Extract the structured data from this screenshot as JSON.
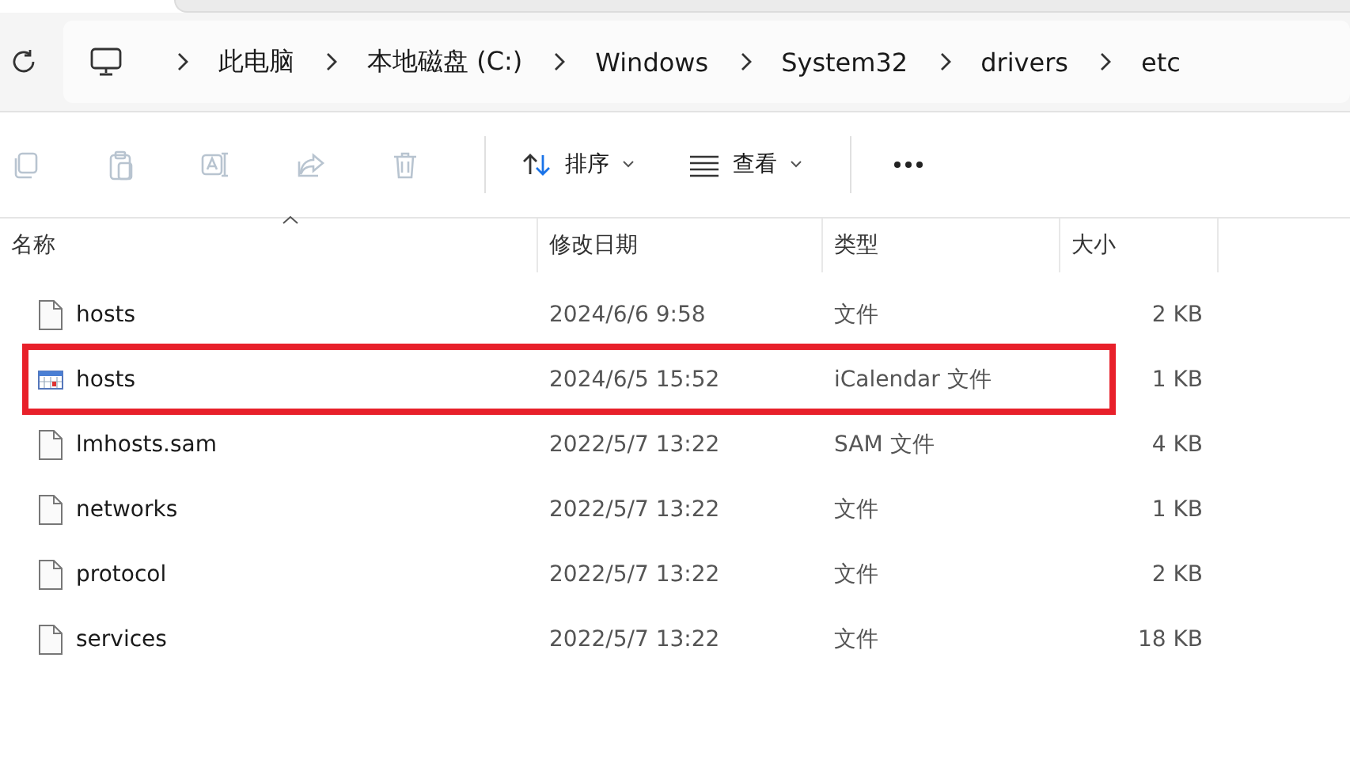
{
  "address_bar": {
    "crumbs": [
      "此电脑",
      "本地磁盘 (C:)",
      "Windows",
      "System32",
      "drivers",
      "etc"
    ]
  },
  "toolbar": {
    "actions": [
      {
        "kind": "copy",
        "disabled": true
      },
      {
        "kind": "paste",
        "disabled": true
      },
      {
        "kind": "rename",
        "disabled": true
      },
      {
        "kind": "share",
        "disabled": true
      },
      {
        "kind": "delete",
        "disabled": true
      }
    ],
    "sort": {
      "label": "排序"
    },
    "view": {
      "label": "查看"
    }
  },
  "table": {
    "columns": [
      "名称",
      "修改日期",
      "类型",
      "大小"
    ],
    "rows": [
      {
        "kind": "file",
        "name": "hosts",
        "modified": "2024/6/6 9:58",
        "type": "文件",
        "size": "2 KB",
        "highlighted": false
      },
      {
        "kind": "calendar",
        "name": "hosts",
        "modified": "2024/6/5 15:52",
        "type": "iCalendar 文件",
        "size": "1 KB",
        "highlighted": true
      },
      {
        "kind": "file",
        "name": "lmhosts.sam",
        "modified": "2022/5/7 13:22",
        "type": "SAM 文件",
        "size": "4 KB",
        "highlighted": false
      },
      {
        "kind": "file",
        "name": "networks",
        "modified": "2022/5/7 13:22",
        "type": "文件",
        "size": "1 KB",
        "highlighted": false
      },
      {
        "kind": "file",
        "name": "protocol",
        "modified": "2022/5/7 13:22",
        "type": "文件",
        "size": "2 KB",
        "highlighted": false
      },
      {
        "kind": "file",
        "name": "services",
        "modified": "2022/5/7 13:22",
        "type": "文件",
        "size": "18 KB",
        "highlighted": false
      }
    ]
  }
}
